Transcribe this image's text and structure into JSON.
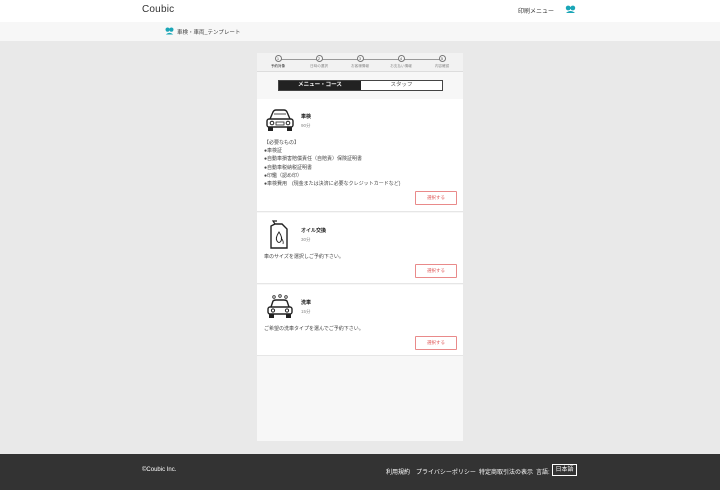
{
  "header": {
    "logo": "Coubic",
    "nav_label": "印刷メニュー",
    "avatar_icon": "user-avatar-icon"
  },
  "breadcrumb": {
    "icon": "store-icon",
    "title": "車検・車両_テンプレート"
  },
  "steps": [
    {
      "num": "1",
      "label": "予約対象",
      "active": true
    },
    {
      "num": "2",
      "label": "日時の選択",
      "active": false
    },
    {
      "num": "3",
      "label": "お客様情報",
      "active": false
    },
    {
      "num": "4",
      "label": "お支払い情報",
      "active": false
    },
    {
      "num": "5",
      "label": "内容確認",
      "active": false
    }
  ],
  "tabs": {
    "menu": "メニュー・コース",
    "staff": "スタッフ"
  },
  "courses": [
    {
      "name": "車検",
      "duration": "90分",
      "icon": "car-icon",
      "description": [
        "【必要なもの】",
        "●車検証",
        "●自動車損害賠償責任（自賠責）保険証明書",
        "●自動車税納税証明書",
        "●印鑑（認め印）",
        "●車検費用　(現金または決済に必要なクレジットカードなど)"
      ],
      "button": "選択する"
    },
    {
      "name": "オイル交換",
      "duration": "30分",
      "icon": "oil-can-icon",
      "description": [
        "車のサイズを選択しご予約下さい。"
      ],
      "button": "選択する"
    },
    {
      "name": "洗車",
      "duration": "15分",
      "icon": "car-wash-icon",
      "description": [
        "ご希望の洗車タイプを選んでご予約下さい。"
      ],
      "button": "選択する"
    }
  ],
  "footer": {
    "copyright": "©Coubic Inc.",
    "links": [
      "利用規約",
      "プライバシーポリシー",
      "特定商取引法の表示"
    ],
    "language_label": "言語:",
    "language": "日本語"
  },
  "colors": {
    "accent": "#e05a5a",
    "brand_icon": "#1aa6b7",
    "footer_bg": "#333333"
  }
}
